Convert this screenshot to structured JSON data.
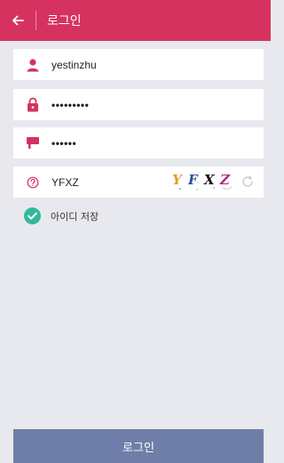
{
  "header": {
    "title": "로그인"
  },
  "form": {
    "username": "yestinzhu",
    "password": "•••••••••",
    "pin": "••••••",
    "captcha_input": "YFXZ",
    "captcha_chars": [
      "Y",
      "F",
      "X",
      "Z"
    ]
  },
  "save_id": {
    "label": "아이디 저장",
    "checked": true
  },
  "login_button": {
    "label": "로그인"
  },
  "colors": {
    "header": "#d6325f",
    "icon": "#d6325f",
    "check": "#2fb89a",
    "button": "#6e7ea8",
    "background": "#e8e9ee"
  },
  "icons": {
    "back": "arrow-left-icon",
    "user": "user-icon",
    "password": "lock-icon",
    "pin": "card-icon",
    "captcha": "question-circle-icon",
    "refresh": "refresh-icon",
    "check": "checkmark-icon"
  }
}
